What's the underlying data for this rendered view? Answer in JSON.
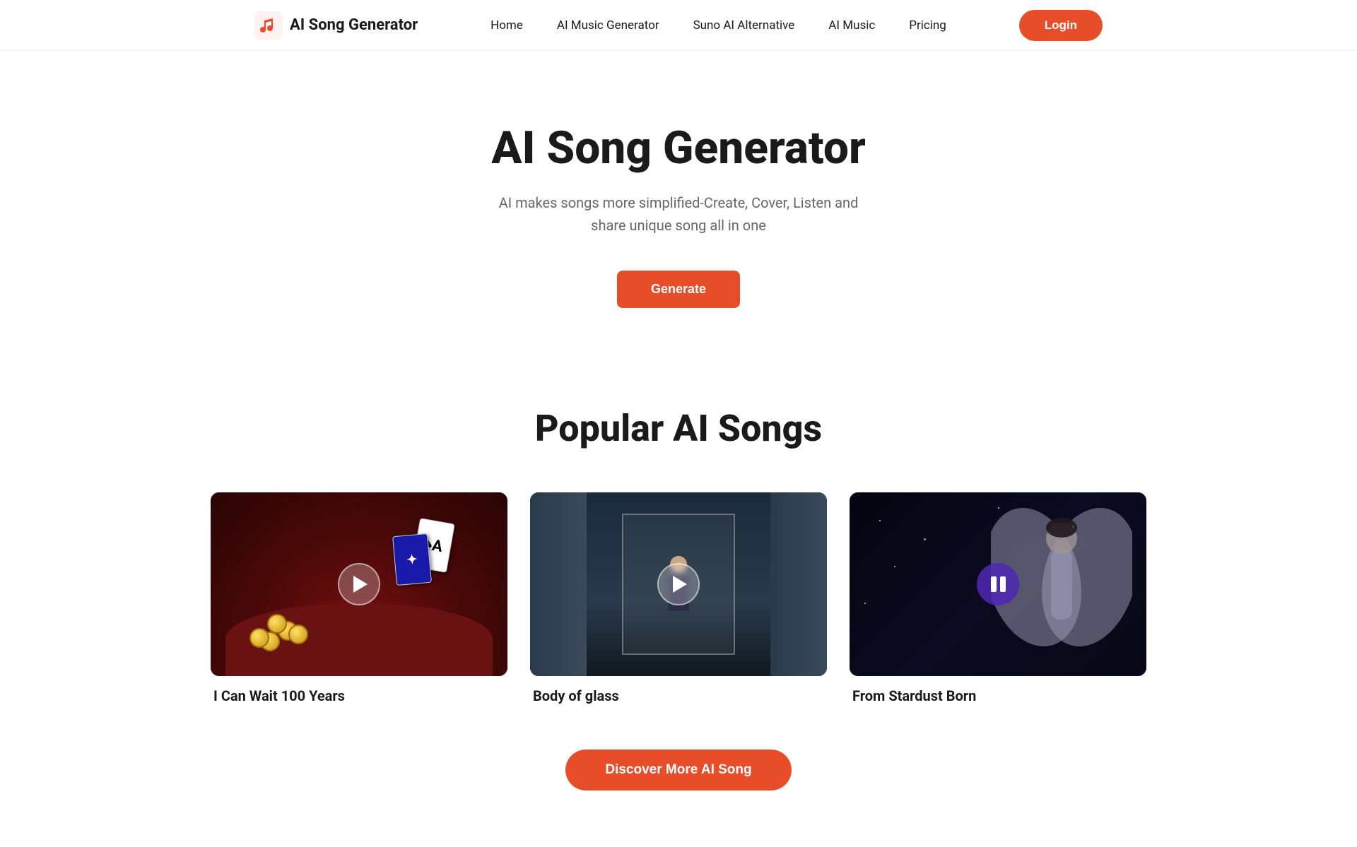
{
  "navbar": {
    "logo_text": "AI Song Generator",
    "links": [
      {
        "id": "home",
        "label": "Home"
      },
      {
        "id": "ai-music-generator",
        "label": "AI Music Generator"
      },
      {
        "id": "suno-ai-alternative",
        "label": "Suno AI Alternative"
      },
      {
        "id": "ai-music",
        "label": "AI Music"
      },
      {
        "id": "pricing",
        "label": "Pricing"
      }
    ],
    "login_label": "Login"
  },
  "hero": {
    "title": "AI Song Generator",
    "subtitle_line1": "AI makes songs more simplified-Create, Cover, Listen and",
    "subtitle_line2": "share unique song all in one",
    "generate_label": "Generate"
  },
  "popular": {
    "section_title": "Popular AI Songs",
    "songs": [
      {
        "id": "can-wait-100-years",
        "title": "I Can Wait 100 Years",
        "play_state": "play",
        "theme": "poker"
      },
      {
        "id": "body-of-glass",
        "title": "Body of glass",
        "play_state": "play",
        "theme": "glass"
      },
      {
        "id": "from-stardust-born",
        "title": "From Stardust Born",
        "play_state": "pause",
        "theme": "stardust"
      }
    ],
    "discover_label": "Discover More AI Song"
  }
}
